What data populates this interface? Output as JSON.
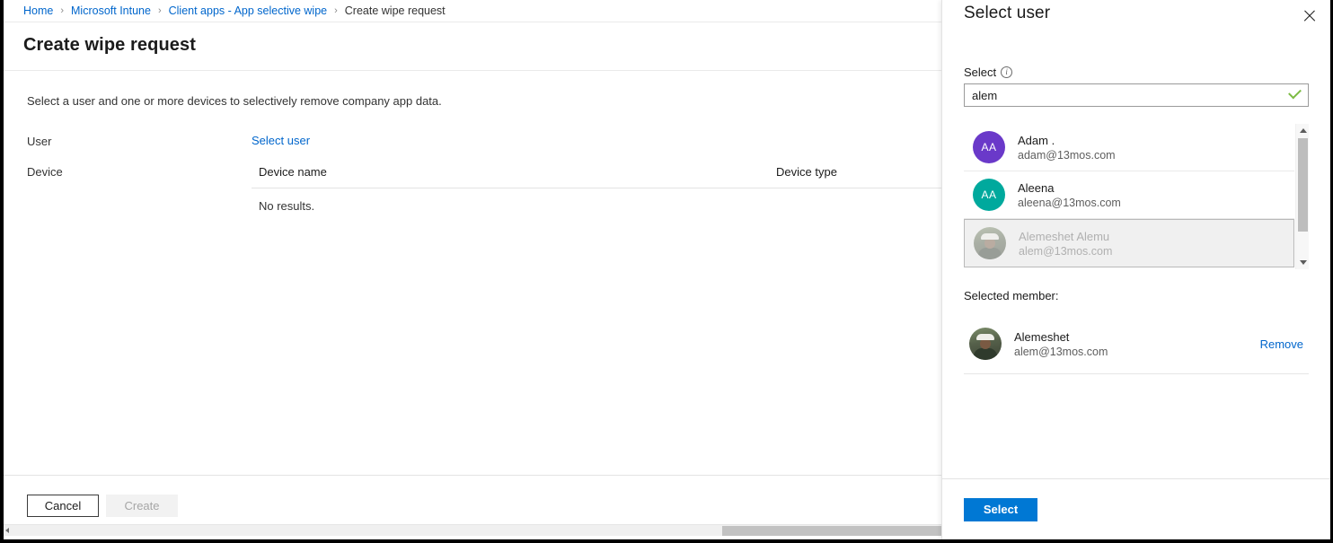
{
  "breadcrumb": {
    "separator": "›",
    "items": [
      {
        "label": "Home",
        "current": false
      },
      {
        "label": "Microsoft Intune",
        "current": false
      },
      {
        "label": "Client apps - App selective wipe",
        "current": false
      },
      {
        "label": "Create wipe request",
        "current": true
      }
    ]
  },
  "page": {
    "title": "Create wipe request",
    "intro": "Select a user and one or more devices to selectively remove company app data."
  },
  "form": {
    "user_label": "User",
    "select_user_link": "Select user",
    "device_label": "Device"
  },
  "device_table": {
    "columns": [
      "Device name",
      "Device type"
    ],
    "empty_message": "No results."
  },
  "footer": {
    "cancel_label": "Cancel",
    "create_label": "Create"
  },
  "panel": {
    "title": "Select user",
    "close_icon": "close-icon",
    "field": {
      "label": "Select",
      "info_icon": "i",
      "value": "alem",
      "placeholder": "",
      "validation_icon": "check-icon"
    },
    "results": [
      {
        "name": "Adam .",
        "email": "adam@13mos.com",
        "avatar_type": "initials",
        "initials": "AA",
        "avatar_color": "#6a39c9",
        "selected": false
      },
      {
        "name": "Aleena",
        "email": "aleena@13mos.com",
        "avatar_type": "initials",
        "initials": "AA",
        "avatar_color": "#00a99d",
        "selected": false
      },
      {
        "name": "Alemeshet Alemu",
        "email": "alem@13mos.com",
        "avatar_type": "photo",
        "initials": "",
        "avatar_color": "",
        "selected": true
      }
    ],
    "selected_member": {
      "title": "Selected member:",
      "name": "Alemeshet",
      "email": "alem@13mos.com",
      "remove_label": "Remove",
      "avatar_type": "photo"
    },
    "select_button_label": "Select"
  },
  "colors": {
    "accent_blue": "#0078d4",
    "link_blue": "#0066cc",
    "valid_green": "#7cbb42",
    "avatar_purple": "#6a39c9",
    "avatar_teal": "#00a99d"
  }
}
